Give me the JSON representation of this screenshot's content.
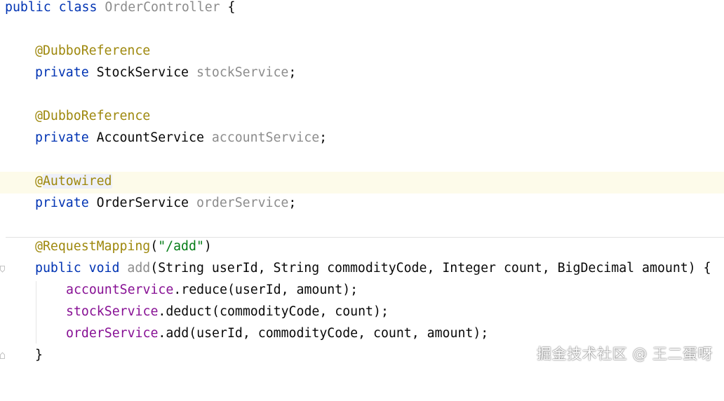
{
  "editor": {
    "language": "Java",
    "lines": {
      "l1": {
        "kw": "public class ",
        "name": "OrderController",
        "rest": " {"
      },
      "l2": {
        "annotation": "@DubboReference"
      },
      "l3": {
        "kw": "private ",
        "type": "StockService ",
        "field": "stockService",
        "end": ";"
      },
      "l4": {
        "annotation": "@DubboReference"
      },
      "l5": {
        "kw": "private ",
        "type": "AccountService ",
        "field": "accountService",
        "end": ";"
      },
      "l6": {
        "at": "@",
        "annotation": "Autowired"
      },
      "l7": {
        "kw": "private ",
        "type": "OrderService ",
        "field": "orderService",
        "end": ";"
      },
      "l8": {
        "annotation": "@RequestMapping",
        "open": "(",
        "str": "\"/add\"",
        "close": ")"
      },
      "l9": {
        "kw1": "public ",
        "kw2": "void ",
        "method": "add",
        "params": "(String userId, String commodityCode, Integer count, BigDecimal amount) {"
      },
      "l10": {
        "field": "accountService",
        "call": ".reduce(userId, amount);"
      },
      "l11": {
        "field": "stockService",
        "call": ".deduct(commodityCode, count);"
      },
      "l12": {
        "field": "orderService",
        "call": ".add(userId, commodityCode, count, amount);"
      },
      "l13": {
        "brace": "}"
      }
    }
  },
  "watermark": "掘金技术社区 @ 王二蛋呀",
  "colors": {
    "keyword": "#0033b3",
    "annotation": "#9e880d",
    "field": "#871094",
    "unused": "#8c8c8c",
    "string": "#067d17",
    "current_line": "#fdfbea"
  }
}
